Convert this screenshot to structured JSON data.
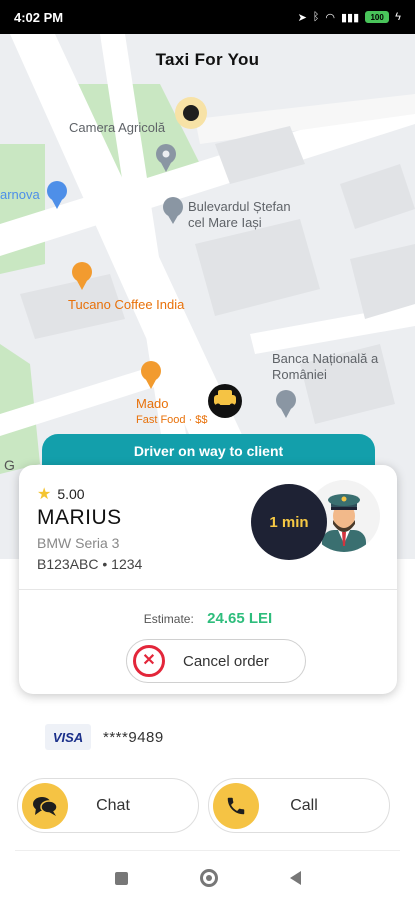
{
  "status_bar": {
    "time": "4:02 PM",
    "battery": "100"
  },
  "header": {
    "title": "Taxi For You"
  },
  "map": {
    "pois": [
      {
        "label": "Camera Agricolă"
      },
      {
        "label": "arnova"
      },
      {
        "label": "Bulevardul Ștefan cel Mare Iași"
      },
      {
        "label": "Tucano Coffee India"
      },
      {
        "label": "Mado"
      },
      {
        "label": "Fast Food · $$"
      },
      {
        "label": "Banca Națională a României"
      }
    ]
  },
  "status_banner": "Driver on way to client",
  "driver": {
    "rating": "5.00",
    "name": "MARIUS",
    "car_model": "BMW Seria 3",
    "plate": "B123ABC • 1234",
    "eta": "1 min"
  },
  "estimate": {
    "label": "Estimate:",
    "price": "24.65 LEI"
  },
  "cancel_label": "Cancel order",
  "payment": {
    "brand": "VISA",
    "card_number": "****9489"
  },
  "actions": {
    "chat_label": "Chat",
    "call_label": "Call"
  },
  "colors": {
    "accent": "#f5c344",
    "banner": "#139fab",
    "price": "#2ebd7c",
    "cancel": "#e3263a",
    "eta_bg": "#1e2234"
  }
}
